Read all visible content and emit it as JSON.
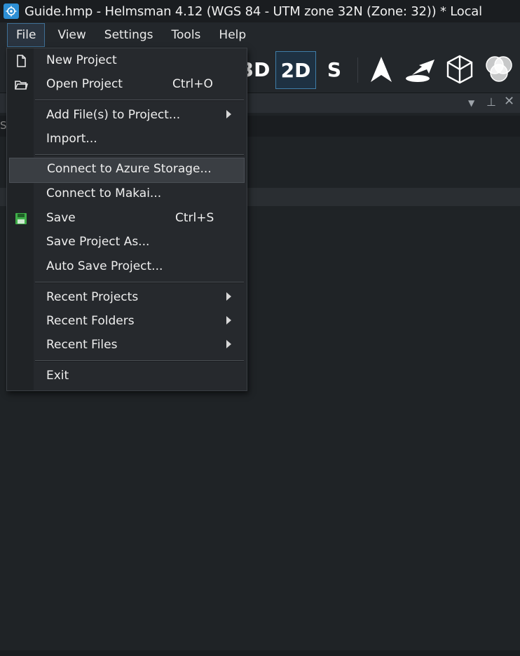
{
  "window": {
    "title": "Guide.hmp - Helmsman 4.12 (WGS 84 - UTM zone 32N (Zone: 32)) * Local"
  },
  "menubar": {
    "items": [
      "File",
      "View",
      "Settings",
      "Tools",
      "Help"
    ]
  },
  "toolbar": {
    "btn_3d": "3D",
    "btn_2d": "2D",
    "btn_s": "S"
  },
  "panel": {
    "left_label": "S"
  },
  "file_menu": {
    "new_project": "New Project",
    "open_project": "Open Project",
    "open_shortcut": "Ctrl+O",
    "add_files": "Add File(s) to Project...",
    "import": "Import...",
    "connect_azure": "Connect to Azure Storage...",
    "connect_makai": "Connect to Makai...",
    "save": "Save",
    "save_shortcut": "Ctrl+S",
    "save_as": "Save Project As...",
    "auto_save": "Auto Save Project...",
    "recent_projects": "Recent Projects",
    "recent_folders": "Recent Folders",
    "recent_files": "Recent Files",
    "exit": "Exit"
  },
  "colors": {
    "accent": "#2d8fd5",
    "save_icon": "#3fae49",
    "background": "#1f2326"
  }
}
